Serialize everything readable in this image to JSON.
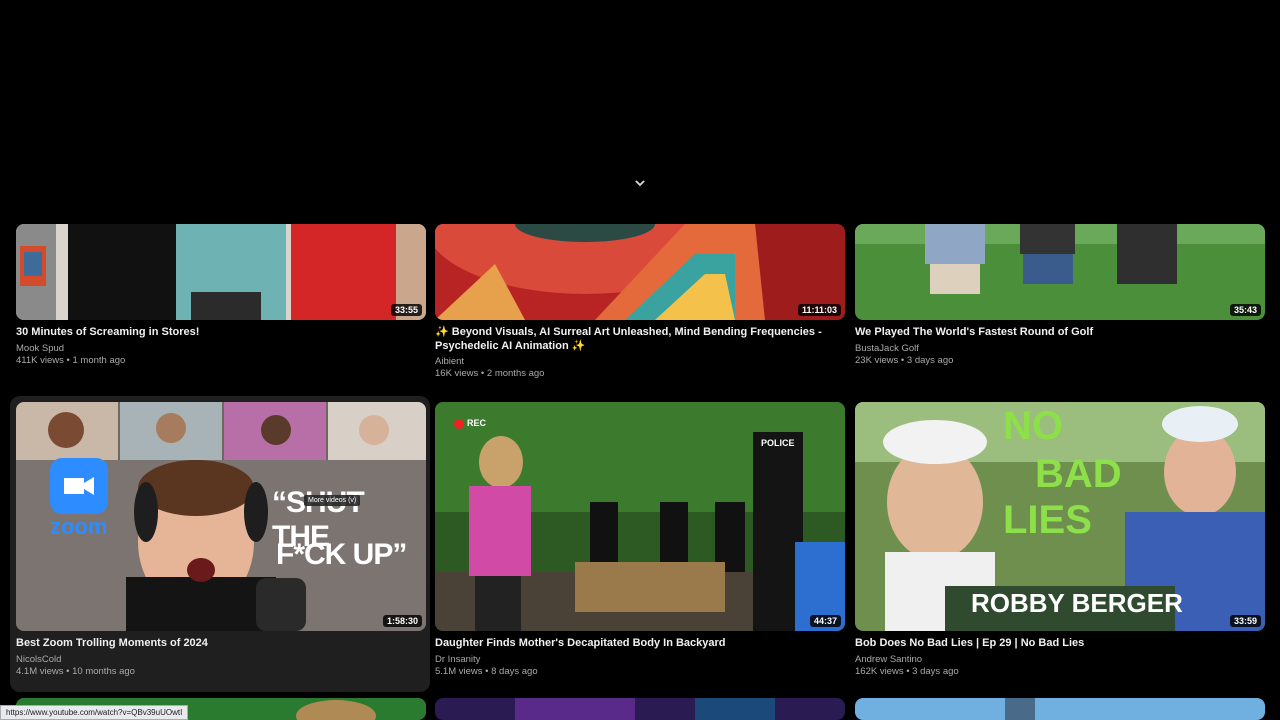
{
  "row1": [
    {
      "title": "30 Minutes of Screaming in Stores!",
      "channel": "Mook Spud",
      "stats": "411K views • 1 month ago",
      "duration": "33:55"
    },
    {
      "title_line1": "✨ Beyond Visuals, AI Surreal Art Unleashed, Mind Bending Frequencies -",
      "title_line2": "Psychedelic AI Animation ✨",
      "channel": "Aibient",
      "stats": "16K views • 2 months ago",
      "duration": "11:11:03"
    },
    {
      "title": "We Played The World's Fastest Round of Golf",
      "channel": "BustaJack Golf",
      "stats": "23K views • 3 days ago",
      "duration": "35:43"
    }
  ],
  "row2": [
    {
      "title": "Best Zoom Trolling Moments of 2024",
      "channel": "NicolsCold",
      "stats": "4.1M views • 10 months ago",
      "duration": "1:58:30",
      "overlay_quote_top": "“SHUT THE",
      "overlay_quote_bottom": "F*CK UP”",
      "overlay_logo": "zoom"
    },
    {
      "title": "Daughter Finds Mother's Decapitated Body In Backyard",
      "channel": "Dr Insanity",
      "stats": "5.1M views • 8 days ago",
      "duration": "44:37",
      "overlay_rec": "REC",
      "overlay_police": "POLICE"
    },
    {
      "title": "Bob Does No Bad Lies | Ep 29 | No Bad Lies",
      "channel": "Andrew Santino",
      "stats": "162K views • 3 days ago",
      "duration": "33:59",
      "overlay_line1": "NO",
      "overlay_line2": "BAD",
      "overlay_line3": "LIES",
      "overlay_name": "ROBBY BERGER"
    }
  ],
  "tooltip": "More videos (v)",
  "status_url": "https://www.youtube.com/watch?v=QBv39uUOwtI"
}
